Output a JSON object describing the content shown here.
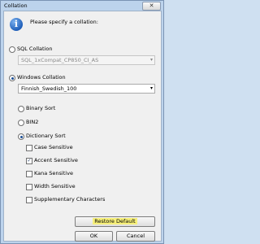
{
  "window": {
    "title": "Collation",
    "close_glyph": "✕"
  },
  "dialog": {
    "prompt": "Please specify a collation:",
    "sql_collation": {
      "label": "SQL Collation",
      "value": "SQL_1xCompat_CP850_CI_AS"
    },
    "windows_collation": {
      "label": "Windows Collation",
      "value": "Finnish_Swedish_100"
    },
    "sort_options": {
      "binary": "Binary Sort",
      "bin2": "BIN2",
      "dictionary": "Dictionary Sort"
    },
    "sensitivity": {
      "case": "Case Sensitive",
      "accent": "Accent Sensitive",
      "kana": "Kana Sensitive",
      "width": "Width Sensitive",
      "supplementary": "Supplementary Characters"
    },
    "buttons": {
      "restore": "Restore Default",
      "ok": "OK",
      "cancel": "Cancel"
    }
  },
  "icons": {
    "info": "i",
    "dropdown_arrow": "▾",
    "check": "✓"
  }
}
